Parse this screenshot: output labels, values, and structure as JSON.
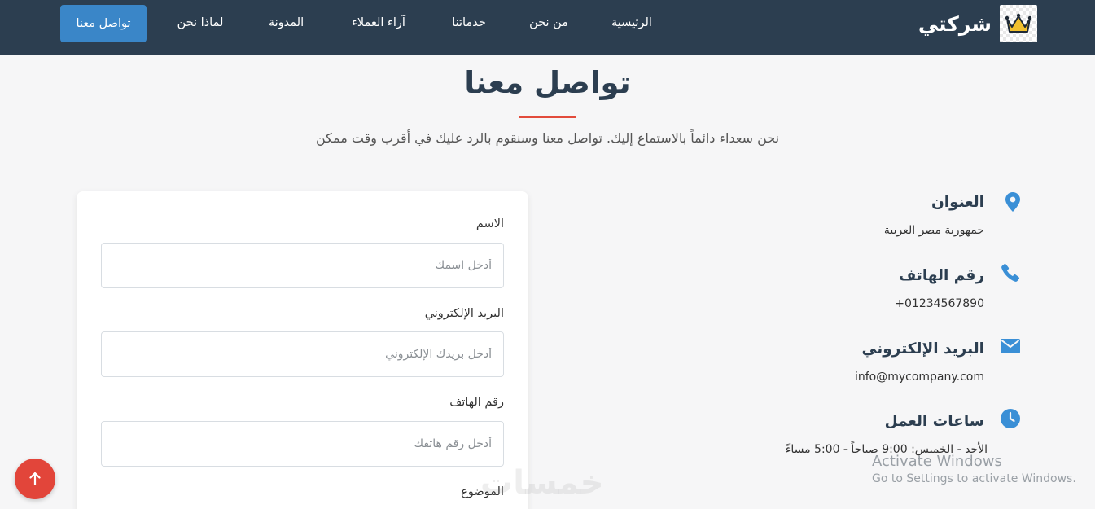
{
  "nav": {
    "brand_name": "شركتي",
    "links": [
      {
        "label": "الرئيسية"
      },
      {
        "label": "من نحن"
      },
      {
        "label": "خدماتنا"
      },
      {
        "label": "آراء العملاء"
      },
      {
        "label": "المدونة"
      },
      {
        "label": "لماذا نحن"
      }
    ],
    "cta_label": "تواصل معنا"
  },
  "section": {
    "title": "تواصل معنا",
    "subtitle": "نحن سعداء دائماً بالاستماع إليك. تواصل معنا وسنقوم بالرد عليك في أقرب وقت ممكن"
  },
  "contact_info": [
    {
      "title": "العنوان",
      "value": "جمهورية مصر العربية",
      "icon": "map-marker-icon"
    },
    {
      "title": "رقم الهاتف",
      "value": "+01234567890",
      "icon": "phone-icon"
    },
    {
      "title": "البريد الإلكتروني",
      "value": "info@mycompany.com",
      "icon": "envelope-icon"
    },
    {
      "title": "ساعات العمل",
      "value": "الأحد - الخميس: 9:00 صباحاً - 5:00 مساءً",
      "icon": "clock-icon"
    }
  ],
  "form": {
    "name_label": "الاسم",
    "name_placeholder": "أدخل اسمك",
    "email_label": "البريد الإلكتروني",
    "email_placeholder": "أدخل بريدك الإلكتروني",
    "phone_label": "رقم الهاتف",
    "phone_placeholder": "أدخل رقم هاتفك",
    "subject_label": "الموضوع"
  },
  "overlay": {
    "watermark": "خمسات",
    "activate_title": "Activate Windows",
    "activate_sub": "Go to Settings to activate Windows."
  },
  "colors": {
    "navbar": "#2c3e50",
    "accent_blue": "#3a86c8",
    "accent_red": "#e24b3b",
    "icon_blue": "#3a8fd6"
  }
}
